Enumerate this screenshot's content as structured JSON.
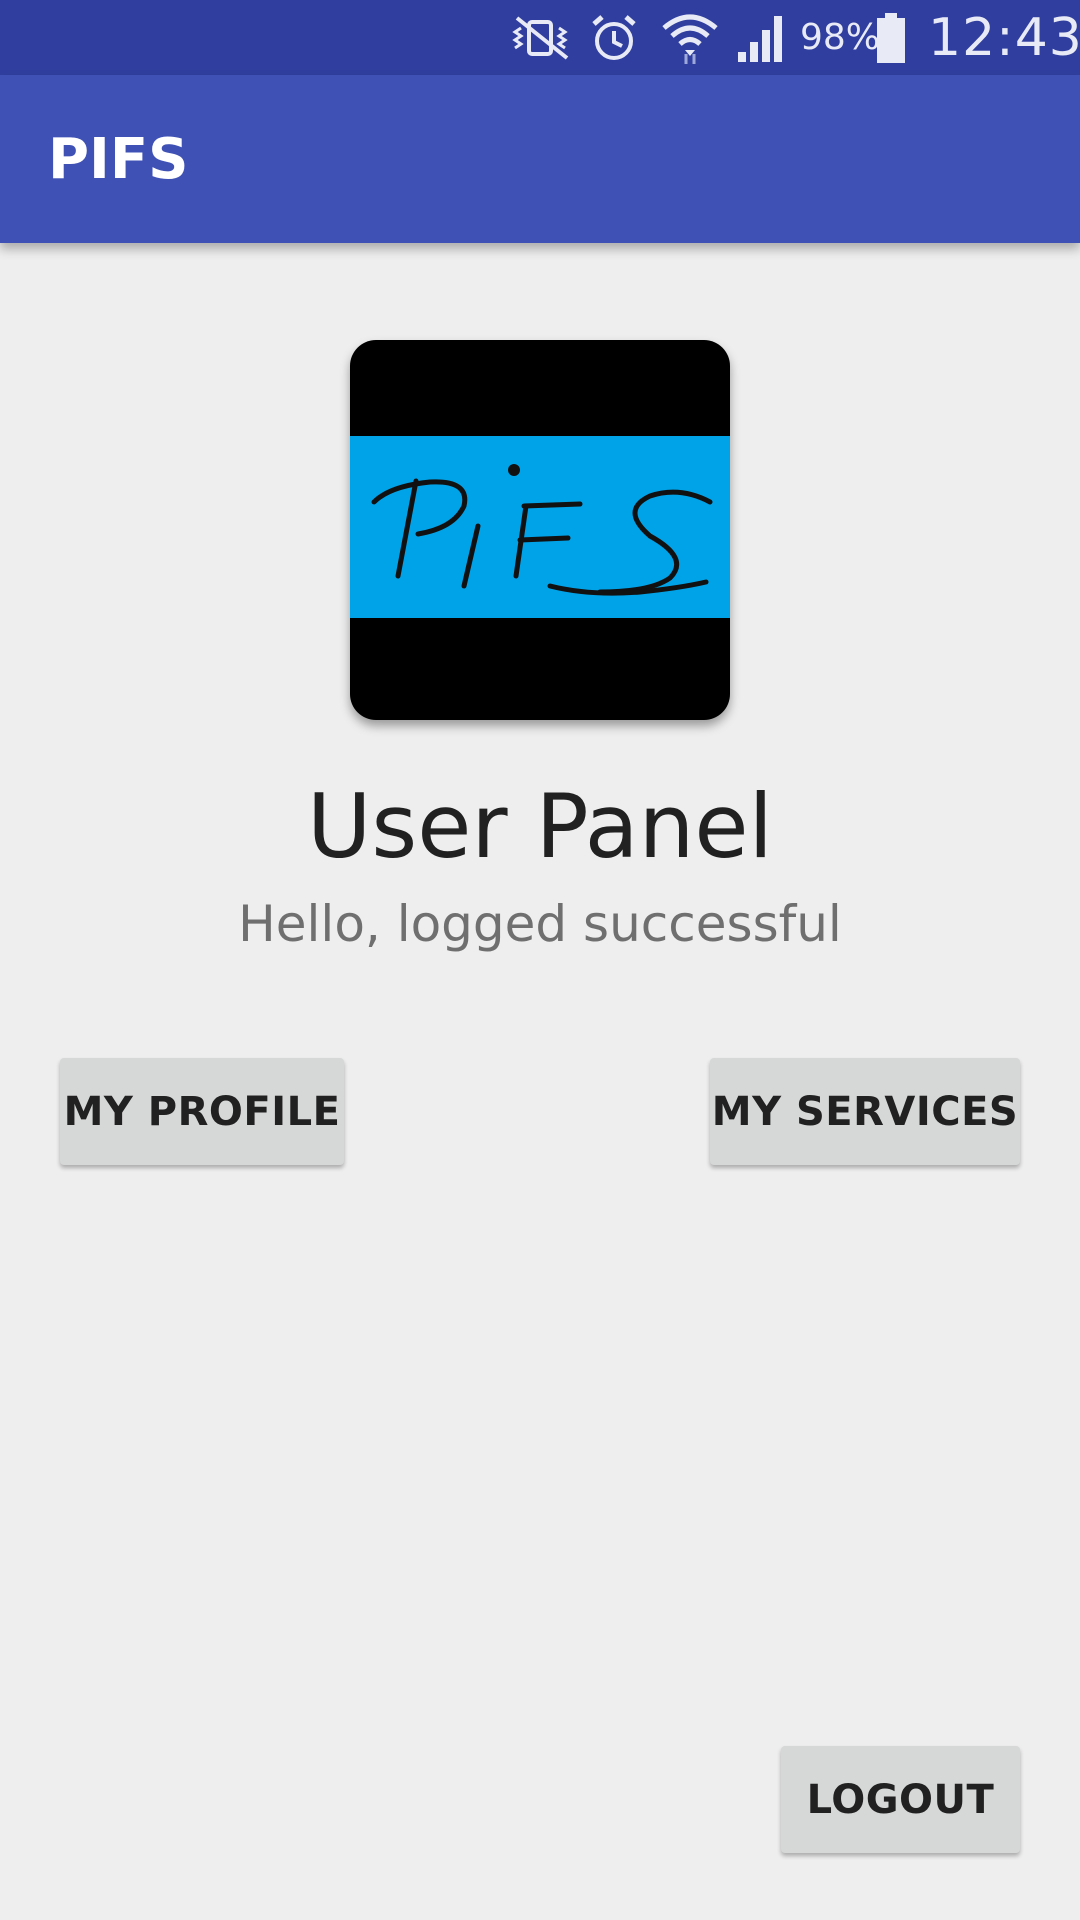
{
  "status_bar": {
    "icons": [
      "mute-vibrate-icon",
      "alarm-icon",
      "wifi-icon",
      "signal-icon",
      "battery-icon"
    ],
    "battery_percent": "98%",
    "time": "12:43"
  },
  "app_bar": {
    "title": "PIFS"
  },
  "logo": {
    "text": "PIFS",
    "colors": {
      "frame": "#000000",
      "band": "#00a2e8"
    }
  },
  "panel": {
    "title": "User Panel",
    "subtitle": "Hello, logged successful"
  },
  "buttons": {
    "my_profile": "MY PROFILE",
    "my_services": "MY SERVICES",
    "logout": "LOGOUT"
  },
  "colors": {
    "status_bar": "#303f9f",
    "app_bar": "#3f51b5",
    "background": "#eeeeee",
    "button": "#d6d7d7"
  }
}
